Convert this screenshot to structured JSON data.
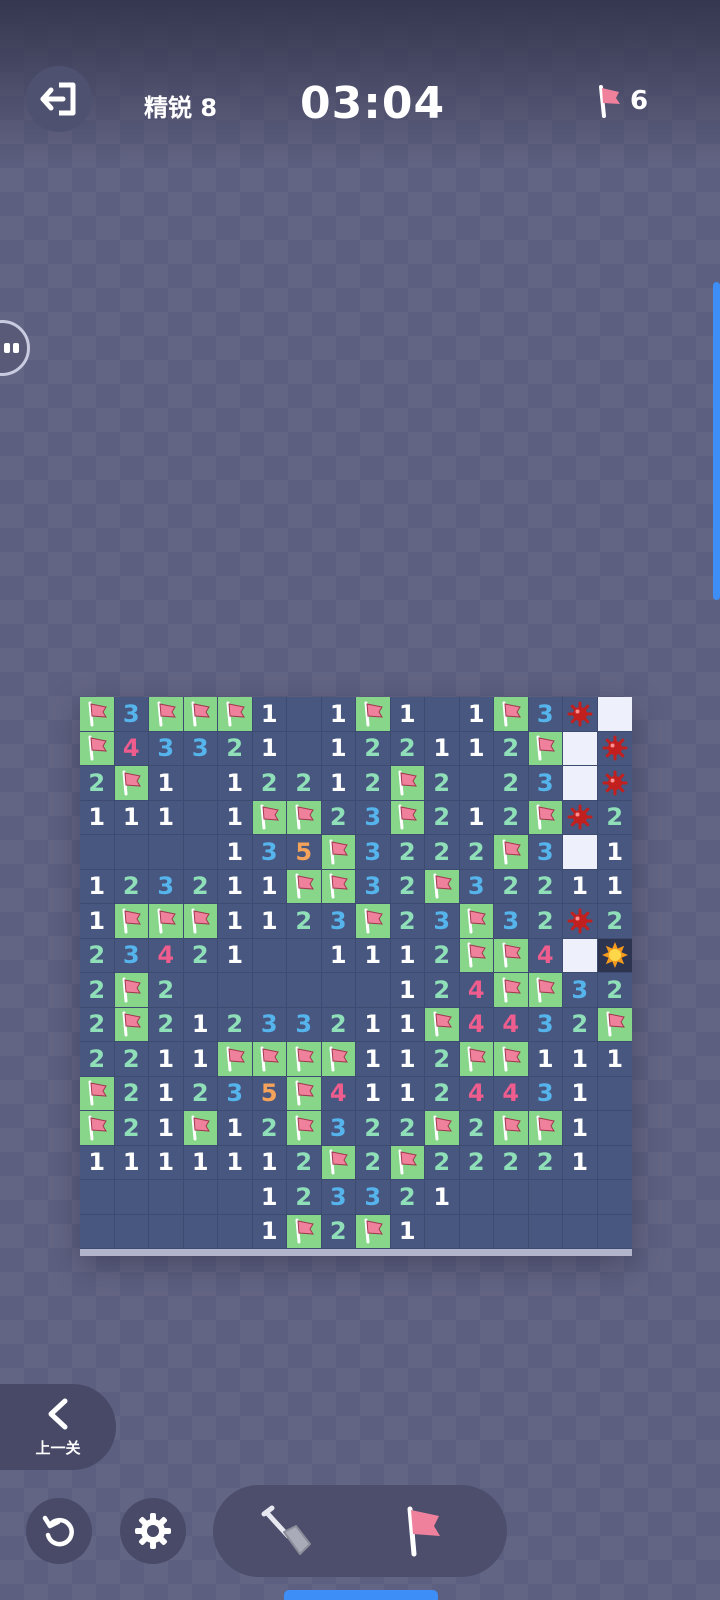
{
  "header": {
    "level_label": "精锐 8",
    "timer": "03:04",
    "flags_remaining": "6"
  },
  "controls": {
    "previous_level_label": "上一关"
  },
  "colors": {
    "background": "#5d5f80",
    "board": "#47577f",
    "flag_cell": "#87d68a",
    "hidden_cell": "#eef0fb",
    "flag": "#f0819c"
  },
  "board": {
    "columns": 16,
    "rows": [
      [
        "F",
        "3",
        "F",
        "F",
        "F",
        "1",
        "",
        "1",
        "F",
        "1",
        "",
        "1",
        "F",
        "3",
        "M",
        "H"
      ],
      [
        "F",
        "4",
        "3",
        "3",
        "2",
        "1",
        "",
        "1",
        "2",
        "2",
        "1",
        "1",
        "2",
        "F",
        "H",
        "M"
      ],
      [
        "2",
        "F",
        "1",
        "",
        "1",
        "2",
        "2",
        "1",
        "2",
        "F",
        "2",
        "",
        "2",
        "3",
        "H",
        "M"
      ],
      [
        "1",
        "1",
        "1",
        "",
        "1",
        "F",
        "F",
        "2",
        "3",
        "F",
        "2",
        "1",
        "2",
        "F",
        "M",
        "2"
      ],
      [
        "",
        "",
        "",
        "",
        "1",
        "3",
        "5",
        "F",
        "3",
        "2",
        "2",
        "2",
        "F",
        "3",
        "H",
        "1"
      ],
      [
        "1",
        "2",
        "3",
        "2",
        "1",
        "1",
        "F",
        "F",
        "3",
        "2",
        "F",
        "3",
        "2",
        "2",
        "1",
        "1"
      ],
      [
        "1",
        "F",
        "F",
        "F",
        "1",
        "1",
        "2",
        "3",
        "F",
        "2",
        "3",
        "F",
        "3",
        "2",
        "M",
        "2"
      ],
      [
        "2",
        "3",
        "4",
        "2",
        "1",
        "",
        "",
        "1",
        "1",
        "1",
        "2",
        "F",
        "F",
        "4",
        "H",
        "X"
      ],
      [
        "2",
        "F",
        "2",
        "",
        "",
        "",
        "",
        "",
        "",
        "1",
        "2",
        "4",
        "F",
        "F",
        "3",
        "2"
      ],
      [
        "2",
        "F",
        "2",
        "1",
        "2",
        "3",
        "3",
        "2",
        "1",
        "1",
        "F",
        "4",
        "4",
        "3",
        "2",
        "F"
      ],
      [
        "2",
        "2",
        "1",
        "1",
        "F",
        "F",
        "F",
        "F",
        "1",
        "1",
        "2",
        "F",
        "F",
        "1",
        "1",
        "1"
      ],
      [
        "F",
        "2",
        "1",
        "2",
        "3",
        "5",
        "F",
        "4",
        "1",
        "1",
        "2",
        "4",
        "4",
        "3",
        "1",
        ""
      ],
      [
        "F",
        "2",
        "1",
        "F",
        "1",
        "2",
        "F",
        "3",
        "2",
        "2",
        "F",
        "2",
        "F",
        "F",
        "1",
        ""
      ],
      [
        "1",
        "1",
        "1",
        "1",
        "1",
        "1",
        "2",
        "F",
        "2",
        "F",
        "2",
        "2",
        "2",
        "2",
        "1",
        ""
      ],
      [
        "",
        "",
        "",
        "",
        "",
        "1",
        "2",
        "3",
        "3",
        "2",
        "1",
        "",
        "",
        "",
        "",
        ""
      ],
      [
        "",
        "",
        "",
        "",
        "",
        "1",
        "F",
        "2",
        "F",
        "1",
        "",
        "",
        "",
        "",
        "",
        ""
      ]
    ]
  }
}
